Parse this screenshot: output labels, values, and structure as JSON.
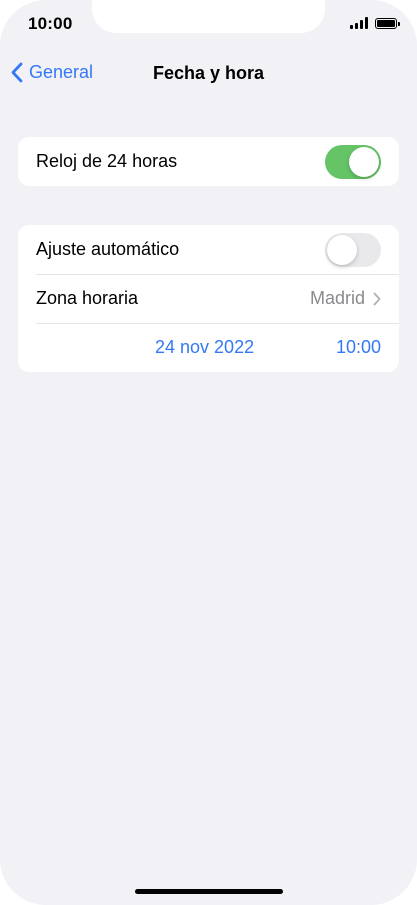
{
  "status_bar": {
    "time": "10:00"
  },
  "navbar": {
    "back_label": "General",
    "title": "Fecha y hora"
  },
  "group1": {
    "clock24": {
      "label": "Reloj de 24 horas",
      "enabled": true
    }
  },
  "group2": {
    "auto_set": {
      "label": "Ajuste automático",
      "enabled": false
    },
    "timezone": {
      "label": "Zona horaria",
      "value": "Madrid"
    },
    "date": "24 nov 2022",
    "time": "10:00"
  },
  "colors": {
    "accent": "#3478f6",
    "toggle_on": "#64c466",
    "toggle_off": "#e9e9eb",
    "background": "#f1f1f6"
  }
}
